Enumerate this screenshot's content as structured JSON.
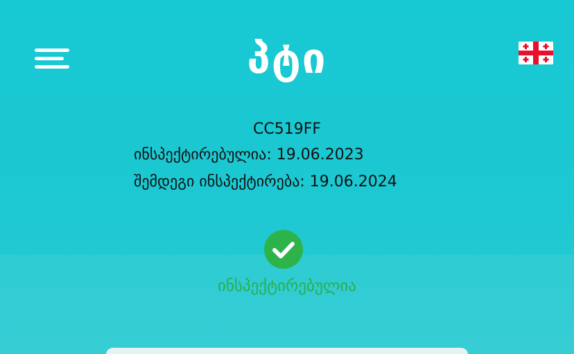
{
  "header": {
    "menu_icon": "hamburger-menu-icon",
    "logo_text": "პტი",
    "language_flag": "georgia-flag-icon"
  },
  "vehicle": {
    "plate": "CC519FF",
    "inspected_line": "ინსპექტირებულია: 19.06.2023",
    "next_inspection_line": "შემდეგი ინსპექტირება: 19.06.2024"
  },
  "status": {
    "icon": "check-circle-icon",
    "label": "ინსპექტირებულია",
    "color": "#2aae4a"
  },
  "colors": {
    "background": "#1cc8d2",
    "flag_red": "#e8112d",
    "card": "#e6f2f3"
  }
}
